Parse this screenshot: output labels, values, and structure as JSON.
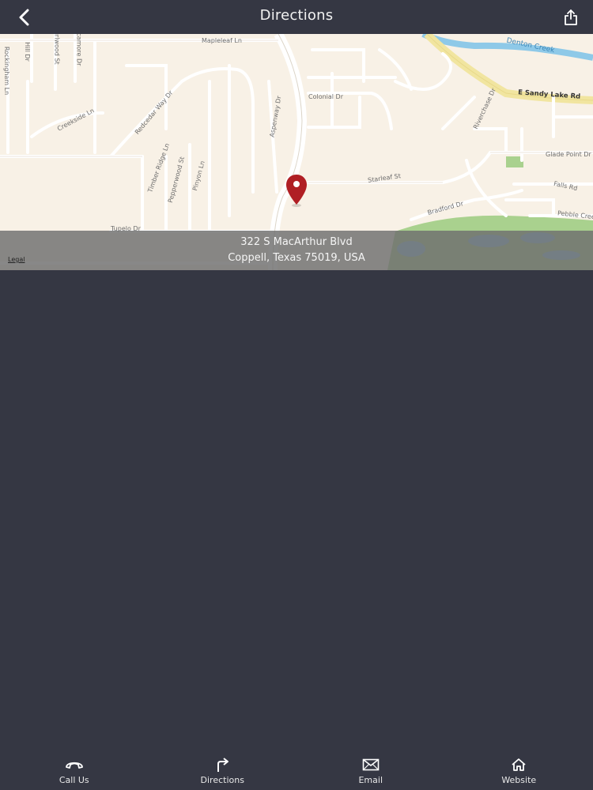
{
  "header": {
    "title": "Directions",
    "back_icon": "chevron-left-icon",
    "share_icon": "share-icon"
  },
  "map": {
    "address_line1": "322 S MacArthur Blvd",
    "address_line2": "Coppell, Texas 75019, USA",
    "legal_label": "Legal",
    "pin_color": "#b01f24",
    "streets": [
      {
        "label": "Mapleleaf Ln",
        "bold": false,
        "water": false
      },
      {
        "label": "Denton Creek",
        "bold": false,
        "water": true
      },
      {
        "label": "E Sandy Lake Rd",
        "bold": true,
        "water": false
      },
      {
        "label": "Colonial Dr",
        "bold": false,
        "water": false
      },
      {
        "label": "Creekside Ln",
        "bold": false,
        "water": false
      },
      {
        "label": "Redcedar Way Dr",
        "bold": false,
        "water": false
      },
      {
        "label": "Aspenway Dr",
        "bold": false,
        "water": false
      },
      {
        "label": "Riverchase Dr",
        "bold": false,
        "water": false
      },
      {
        "label": "Glade Point Dr",
        "bold": false,
        "water": false
      },
      {
        "label": "Timber Ridge Ln",
        "bold": false,
        "water": false
      },
      {
        "label": "Pepperwood St",
        "bold": false,
        "water": false
      },
      {
        "label": "Pinyon Ln",
        "bold": false,
        "water": false
      },
      {
        "label": "Starleaf St",
        "bold": false,
        "water": false
      },
      {
        "label": "Falls Rd",
        "bold": false,
        "water": false
      },
      {
        "label": "Bradford Dr",
        "bold": false,
        "water": false
      },
      {
        "label": "Pebble Creek",
        "bold": false,
        "water": false
      },
      {
        "label": "Tupelo Dr",
        "bold": false,
        "water": false
      },
      {
        "label": "Hill Dr",
        "bold": false,
        "water": false
      },
      {
        "label": "Rockingham Ln",
        "bold": false,
        "water": false
      },
      {
        "label": "Burlwood St",
        "bold": false,
        "water": false
      },
      {
        "label": "Sycamore Dr",
        "bold": false,
        "water": false
      }
    ]
  },
  "tabs": [
    {
      "label": "Call Us",
      "icon": "phone-icon"
    },
    {
      "label": "Directions",
      "icon": "turn-right-arrow-icon"
    },
    {
      "label": "Email",
      "icon": "envelope-icon"
    },
    {
      "label": "Website",
      "icon": "home-icon"
    }
  ],
  "colors": {
    "background": "#353743",
    "map_land": "#f8f1e6",
    "water": "#8ec9e8",
    "park": "#a9d18e",
    "pin": "#b01f24"
  }
}
